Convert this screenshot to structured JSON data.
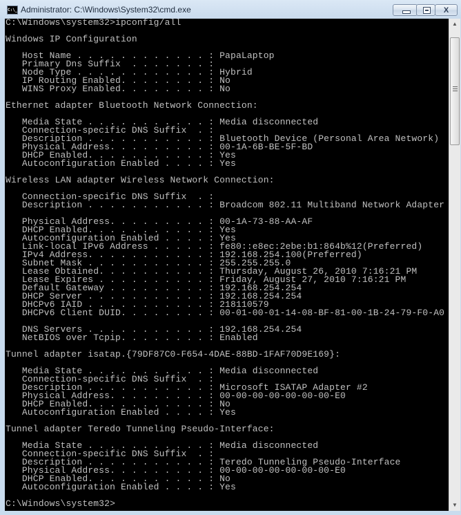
{
  "window": {
    "title": "Administrator: C:\\Windows\\System32\\cmd.exe",
    "icon": "cmd-icon",
    "icon_text": "C:\\_",
    "controls": {
      "minimize": "minimize-icon",
      "maximize": "maximize-icon",
      "close": "close-icon",
      "close_glyph": "X"
    }
  },
  "console": {
    "lines": [
      "C:\\Windows\\system32>ipconfig/all",
      "",
      "Windows IP Configuration",
      "",
      "   Host Name . . . . . . . . . . . . : PapaLaptop",
      "   Primary Dns Suffix  . . . . . . . :",
      "   Node Type . . . . . . . . . . . . : Hybrid",
      "   IP Routing Enabled. . . . . . . . : No",
      "   WINS Proxy Enabled. . . . . . . . : No",
      "",
      "Ethernet adapter Bluetooth Network Connection:",
      "",
      "   Media State . . . . . . . . . . . : Media disconnected",
      "   Connection-specific DNS Suffix  . :",
      "   Description . . . . . . . . . . . : Bluetooth Device (Personal Area Network)",
      "   Physical Address. . . . . . . . . : 00-1A-6B-BE-5F-BD",
      "   DHCP Enabled. . . . . . . . . . . : Yes",
      "   Autoconfiguration Enabled . . . . : Yes",
      "",
      "Wireless LAN adapter Wireless Network Connection:",
      "",
      "   Connection-specific DNS Suffix  . :",
      "   Description . . . . . . . . . . . : Broadcom 802.11 Multiband Network Adapter",
      "",
      "   Physical Address. . . . . . . . . : 00-1A-73-88-AA-AF",
      "   DHCP Enabled. . . . . . . . . . . : Yes",
      "   Autoconfiguration Enabled . . . . : Yes",
      "   Link-local IPv6 Address . . . . . : fe80::e8ec:2ebe:b1:864b%12(Preferred)",
      "   IPv4 Address. . . . . . . . . . . : 192.168.254.100(Preferred)",
      "   Subnet Mask . . . . . . . . . . . : 255.255.255.0",
      "   Lease Obtained. . . . . . . . . . : Thursday, August 26, 2010 7:16:21 PM",
      "   Lease Expires . . . . . . . . . . : Friday, August 27, 2010 7:16:21 PM",
      "   Default Gateway . . . . . . . . . : 192.168.254.254",
      "   DHCP Server . . . . . . . . . . . : 192.168.254.254",
      "   DHCPv6 IAID . . . . . . . . . . . : 218110579",
      "   DHCPv6 Client DUID. . . . . . . . : 00-01-00-01-14-08-BF-81-00-1B-24-79-F0-A0",
      "",
      "   DNS Servers . . . . . . . . . . . : 192.168.254.254",
      "   NetBIOS over Tcpip. . . . . . . . : Enabled",
      "",
      "Tunnel adapter isatap.{79DF87C0-F654-4DAE-88BD-1FAF70D9E169}:",
      "",
      "   Media State . . . . . . . . . . . : Media disconnected",
      "   Connection-specific DNS Suffix  . :",
      "   Description . . . . . . . . . . . : Microsoft ISATAP Adapter #2",
      "   Physical Address. . . . . . . . . : 00-00-00-00-00-00-00-E0",
      "   DHCP Enabled. . . . . . . . . . . : No",
      "   Autoconfiguration Enabled . . . . : Yes",
      "",
      "Tunnel adapter Teredo Tunneling Pseudo-Interface:",
      "",
      "   Media State . . . . . . . . . . . : Media disconnected",
      "   Connection-specific DNS Suffix  . :",
      "   Description . . . . . . . . . . . : Teredo Tunneling Pseudo-Interface",
      "   Physical Address. . . . . . . . . : 00-00-00-00-00-00-00-E0",
      "   DHCP Enabled. . . . . . . . . . . : No",
      "   Autoconfiguration Enabled . . . . : Yes",
      "",
      "C:\\Windows\\system32>"
    ]
  },
  "scrollbar": {
    "up_glyph": "▲",
    "down_glyph": "▼"
  }
}
